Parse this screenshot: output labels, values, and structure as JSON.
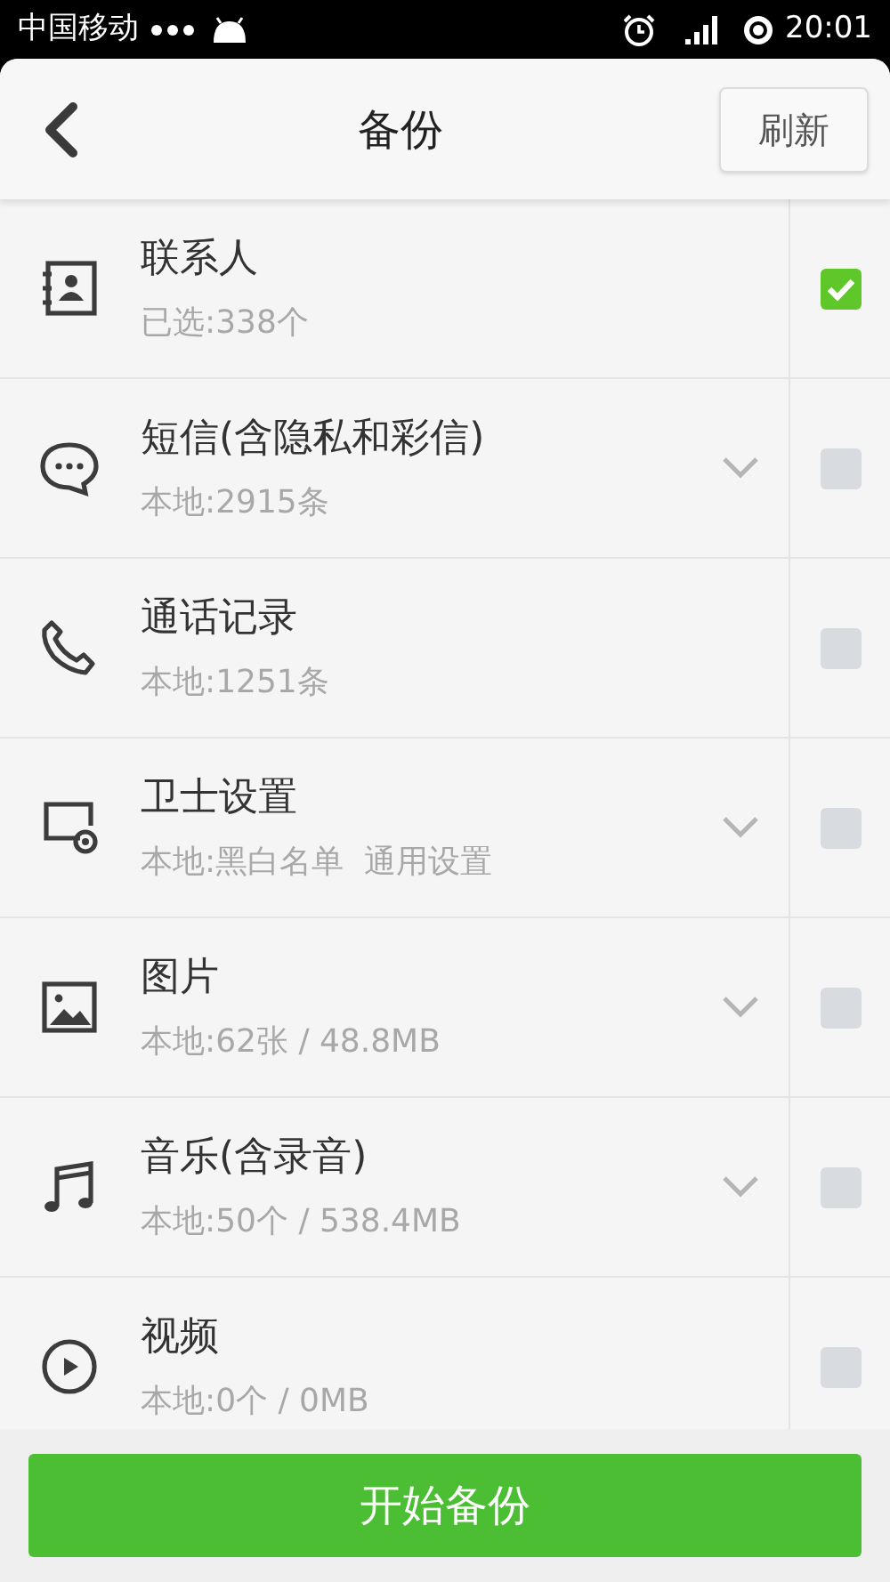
{
  "status_bar": {
    "carrier": "中国移动",
    "time": "20:01"
  },
  "header": {
    "title": "备份",
    "refresh_button": "刷新"
  },
  "items": [
    {
      "title": "联系人",
      "subtitle": "已选:338个",
      "expandable": false,
      "checked": true
    },
    {
      "title": "短信(含隐私和彩信)",
      "subtitle": "本地:2915条",
      "expandable": true,
      "checked": false
    },
    {
      "title": "通话记录",
      "subtitle": "本地:1251条",
      "expandable": false,
      "checked": false
    },
    {
      "title": "卫士设置",
      "subtitle": "本地:黑白名单  通用设置",
      "expandable": true,
      "checked": false
    },
    {
      "title": "图片",
      "subtitle": "本地:62张 / 48.8MB",
      "expandable": true,
      "checked": false
    },
    {
      "title": "音乐(含录音)",
      "subtitle": "本地:50个 / 538.4MB",
      "expandable": true,
      "checked": false
    },
    {
      "title": "视频",
      "subtitle": "本地:0个 / 0MB",
      "expandable": false,
      "checked": false
    }
  ],
  "start_button": "开始备份"
}
